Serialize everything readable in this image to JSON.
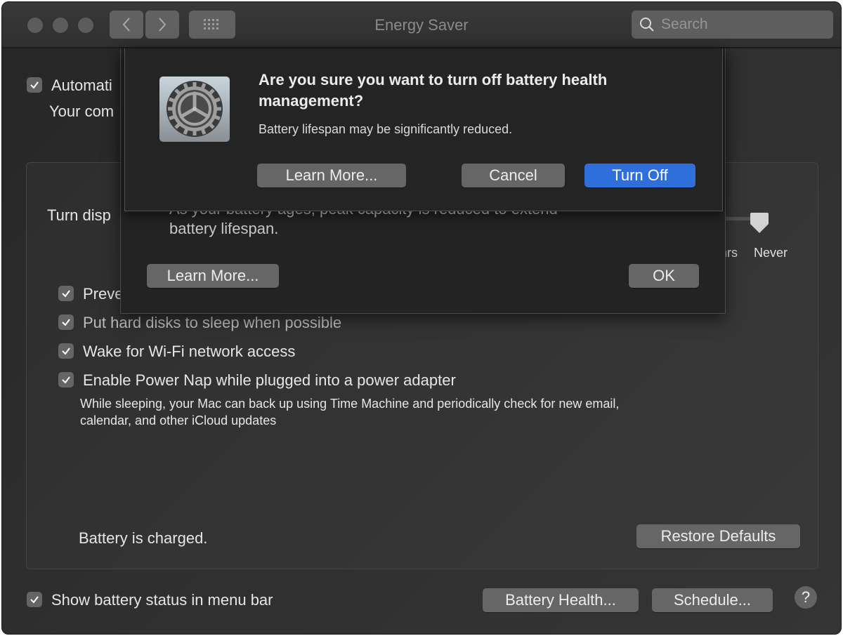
{
  "window": {
    "title": "Energy Saver",
    "search_placeholder": "Search",
    "nav_icons": [
      "back-chevron-icon",
      "forward-chevron-icon",
      "grid-icon"
    ]
  },
  "main": {
    "auto_graphics": {
      "label": "Automati",
      "checked": true,
      "description": "Your com"
    },
    "turn_display_label": "Turn disp",
    "slider": {
      "value_label": "Never",
      "partial_tick_label": "hrs",
      "value_fraction": 1.0
    },
    "options": [
      {
        "label": "Preve",
        "checked": true
      },
      {
        "label": "Put hard disks to sleep when possible",
        "checked": true
      },
      {
        "label": "Wake for Wi-Fi network access",
        "checked": true
      },
      {
        "label": "Enable Power Nap while plugged into a power adapter",
        "checked": true
      }
    ],
    "power_nap_description_line1": "While sleeping, your Mac can back up using Time Machine and periodically check for new email,",
    "power_nap_description_line2": "calendar, and other iCloud updates",
    "battery_status": "Battery is charged.",
    "restore_defaults": "Restore Defaults"
  },
  "footer": {
    "show_battery_status": {
      "label": "Show battery status in menu bar",
      "checked": true
    },
    "battery_health_button": "Battery Health...",
    "schedule_button": "Schedule...",
    "help_label": "?"
  },
  "battery_health_sheet": {
    "partial_text_line1": "As your battery ages, peak capacity is reduced to extend",
    "text_line2": "battery lifespan.",
    "learn_more": "Learn More...",
    "ok": "OK"
  },
  "confirm_dialog": {
    "icon": "system-preferences-gear-icon",
    "title_line1": "Are you sure you want to turn off battery health",
    "title_line2": "management?",
    "message": "Battery lifespan may be significantly reduced.",
    "learn_more": "Learn More...",
    "cancel": "Cancel",
    "turn_off": "Turn Off",
    "accent_color": "#2f6fdc"
  }
}
